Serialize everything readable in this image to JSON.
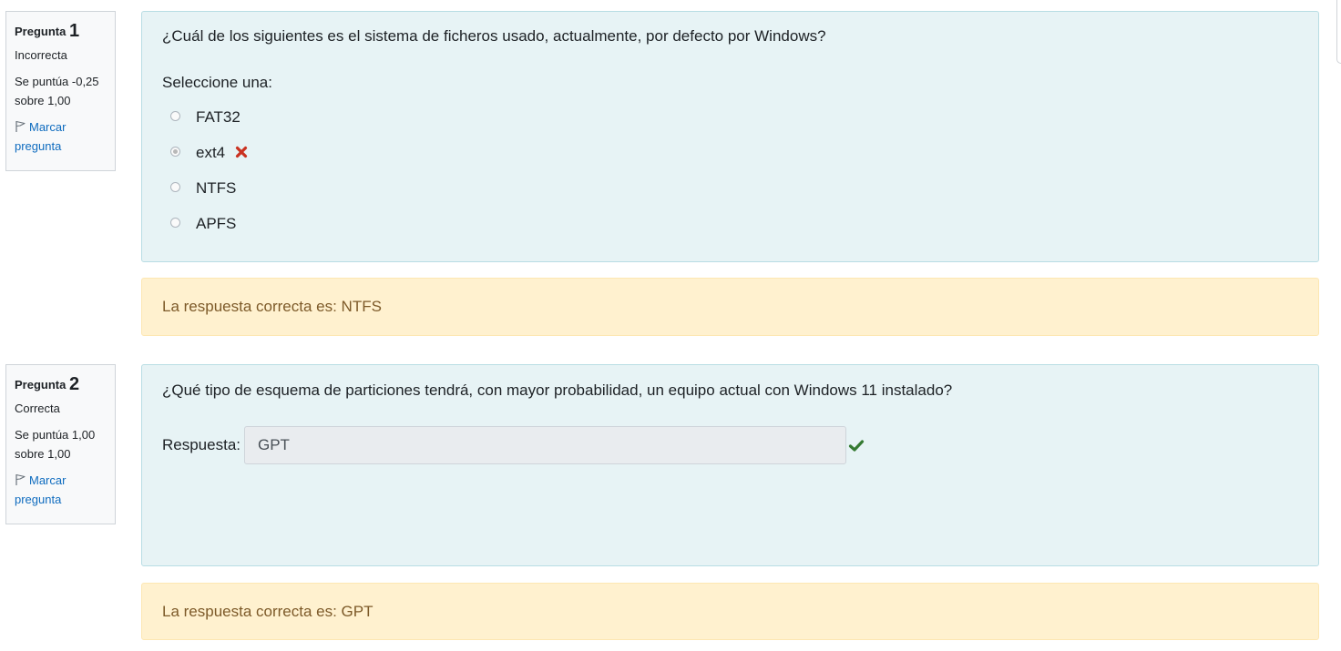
{
  "questions": [
    {
      "info": {
        "label": "Pregunta",
        "number": "1",
        "state": "Incorrecta",
        "grade_line1": "Se puntúa -0,25",
        "grade_line2": "sobre 1,00",
        "flag_line1": "Marcar",
        "flag_line2": "pregunta"
      },
      "text": "¿Cuál de los siguientes es el sistema de ficheros usado, actualmente, por defecto por Windows?",
      "prompt": "Seleccione una:",
      "options": [
        {
          "label": "FAT32",
          "selected": false
        },
        {
          "label": "ext4",
          "selected": true,
          "mark": "incorrect"
        },
        {
          "label": "NTFS",
          "selected": false
        },
        {
          "label": "APFS",
          "selected": false
        }
      ],
      "feedback": "La respuesta correcta es: NTFS"
    },
    {
      "info": {
        "label": "Pregunta",
        "number": "2",
        "state": "Correcta",
        "grade_line1": "Se puntúa 1,00",
        "grade_line2": "sobre 1,00",
        "flag_line1": "Marcar",
        "flag_line2": "pregunta"
      },
      "text": "¿Qué tipo de esquema de particiones tendrá, con mayor probabilidad, un equipo actual con Windows 11 instalado?",
      "answer_label": "Respuesta:",
      "answer_value": "GPT",
      "answer_mark": "correct",
      "feedback": "La respuesta correcta es: GPT"
    }
  ],
  "colors": {
    "link": "#0f6cbf",
    "incorrect": "#ca3120",
    "correct": "#357a32",
    "formulation_bg": "#e7f3f5",
    "feedback_bg": "#fff1cf",
    "feedback_text": "#7d5a29"
  },
  "icons": {
    "flag": "flag-icon",
    "incorrect": "cross-icon",
    "correct": "check-icon"
  }
}
